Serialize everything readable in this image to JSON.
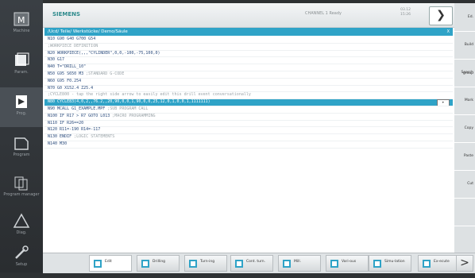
{
  "left_nav": [
    {
      "id": "machine",
      "label": "Machine"
    },
    {
      "id": "params",
      "label": "Param."
    },
    {
      "id": "program",
      "label": "Prog."
    },
    {
      "id": "program-manager",
      "label": "Program"
    },
    {
      "id": "diagnostics",
      "label": "Program manager"
    },
    {
      "id": "setup",
      "label": "Diag."
    },
    {
      "id": "service",
      "label": "Setup"
    }
  ],
  "header": {
    "brand": "SIEMENS",
    "status": "CHANNEL 1  Ready",
    "date": "03.12\n15:26",
    "back_symbol": "❯"
  },
  "file_bar": {
    "path": "/Ucd/ Teile/ Werkstücke/ Demo/Säule",
    "close": "X"
  },
  "code_lines": [
    {
      "text": "N10 G90 G40 G700 G54",
      "comment": ""
    },
    {
      "text": "",
      "comment": ";WORKPIECE DEFINITION"
    },
    {
      "text": "N20 WORKPIECE(,,,\"CYLINDER\",0,0,-100,-75,100,0)",
      "comment": ""
    },
    {
      "text": "N30 G17",
      "comment": ""
    },
    {
      "text": "N40 T=\"DRILL_10\"",
      "comment": ""
    },
    {
      "text": "N50 G95 S650 M3",
      "comment": "  ;STANDARD G-CODE"
    },
    {
      "text": "N60 G95 F0.254",
      "comment": ""
    },
    {
      "text": "N70 G0 X152.4 Z25.4",
      "comment": ""
    },
    {
      "text": "",
      "comment": ";CYCLE800 - tap the right side arrow to easily edit this drill event conversationally"
    },
    {
      "text": "N80 CYCLE83(4,0,2,,76.2,,20,90,0,0,1,90,0,0,25,12,0,1,0,0,1,1111111)",
      "comment": "",
      "highlight": true
    },
    {
      "text": "N90 MCALL G1_EXAMPLE.MPF",
      "comment": "     ;SUB PROGRAM CALL"
    },
    {
      "text": "N100 IF R17 > R7 GOTO L013",
      "comment": "     ;MACRO PROGRAMMING"
    },
    {
      "text": "N110 IF R26==20",
      "comment": ""
    },
    {
      "text": "N120 R11=-190 R14=-117",
      "comment": ""
    },
    {
      "text": "N130 ENDIF",
      "comment": "              ;LOGIC STATEMENTS"
    },
    {
      "text": "N140 M30",
      "comment": ""
    }
  ],
  "right_softkeys": [
    "Ed.",
    "Build group",
    "Search",
    "Mark",
    "Copy",
    "Paste",
    "Cut",
    "",
    ""
  ],
  "bottom_softkeys": [
    {
      "id": "edit",
      "label": "Edit",
      "active": true
    },
    {
      "id": "drilling",
      "label": "Drilling"
    },
    {
      "id": "turning",
      "label": "Turn-ing"
    },
    {
      "id": "contour",
      "label": "Cont. turn."
    },
    {
      "id": "milling",
      "label": "Mill."
    },
    {
      "id": "various",
      "label": "Vari-ous"
    },
    {
      "id": "simulate",
      "label": "Simu-lation"
    },
    {
      "id": "execute",
      "label": "Ex-ecute"
    }
  ],
  "colors": {
    "accent": "#2fa3c7",
    "code_text": "#2a4b7c",
    "comment": "#9aa3a8"
  }
}
